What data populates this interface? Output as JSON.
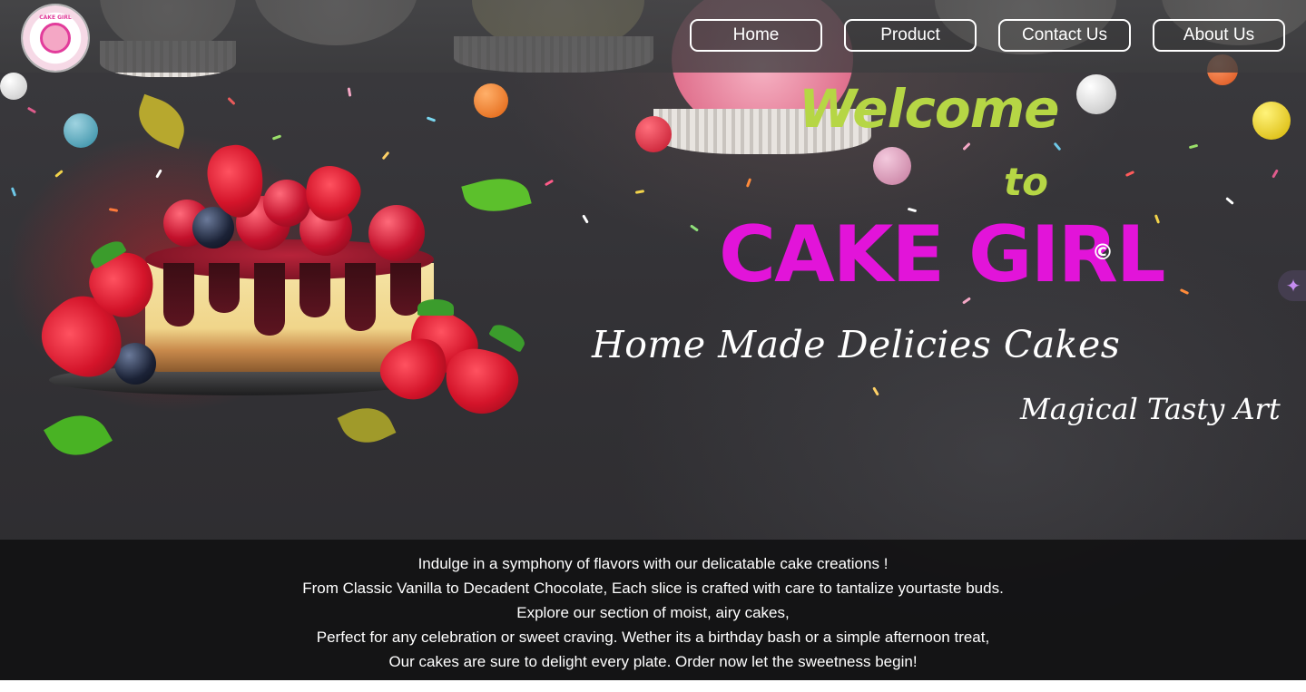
{
  "logo": {
    "name": "cake-girl-logo",
    "text": "CAKE GIRL"
  },
  "nav": {
    "items": [
      {
        "label": "Home"
      },
      {
        "label": "Product"
      },
      {
        "label": "Contact Us"
      },
      {
        "label": "About Us"
      }
    ]
  },
  "hero": {
    "welcome": "Welcome",
    "to": "to",
    "brand": "CAKE GIRL",
    "copyright": "©",
    "tagline": "Home Made Delicies Cakes",
    "subtagline": "Magical Tasty Art",
    "sparkle_icon": "✦"
  },
  "banner": {
    "lines": [
      "Indulge in a symphony of flavors with our delicatable cake creations !",
      "From Classic Vanilla to Decadent Chocolate, Each slice is crafted with care to tantalize yourtaste buds.",
      "Explore our section of moist, airy cakes,",
      "Perfect for any celebration or sweet craving. Wether its a birthday bash or a simple afternoon treat,",
      "Our cakes are sure to delight every plate. Order now let the sweetness begin!"
    ]
  },
  "colors": {
    "accent_green": "#b6d645",
    "brand_magenta": "#e214d9",
    "nav_border": "#ffffff",
    "banner_bg": "#121213"
  },
  "icons": [
    "sparkle-icon",
    "cake-image",
    "logo-image"
  ]
}
